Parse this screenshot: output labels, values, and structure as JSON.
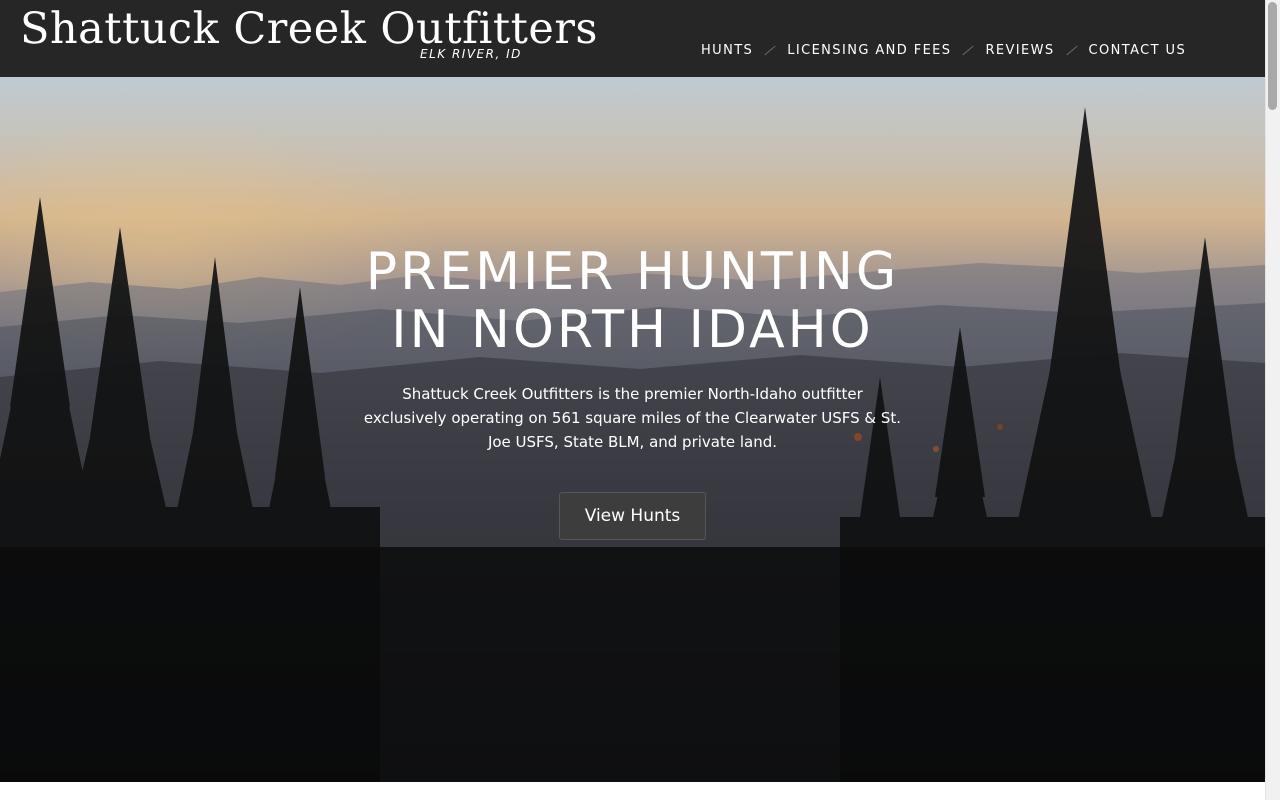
{
  "header": {
    "site_title": "Shattuck Creek Outfitters",
    "tagline": "ELK RIVER, ID",
    "nav": [
      {
        "label": "HUNTS"
      },
      {
        "label": "LICENSING AND FEES"
      },
      {
        "label": "REVIEWS"
      },
      {
        "label": "CONTACT US"
      }
    ]
  },
  "hero": {
    "title_line1": "PREMIER HUNTING",
    "title_line2": "IN NORTH IDAHO",
    "description": "Shattuck Creek Outfitters is the premier North-Idaho outfitter exclusively operating on 561 square miles of the Clearwater USFS & St. Joe USFS, State BLM, and private land.",
    "button_label": "View Hunts"
  },
  "colors": {
    "header_bg": "#262626",
    "button_bg": "#3e3e3e",
    "text": "#ffffff"
  }
}
